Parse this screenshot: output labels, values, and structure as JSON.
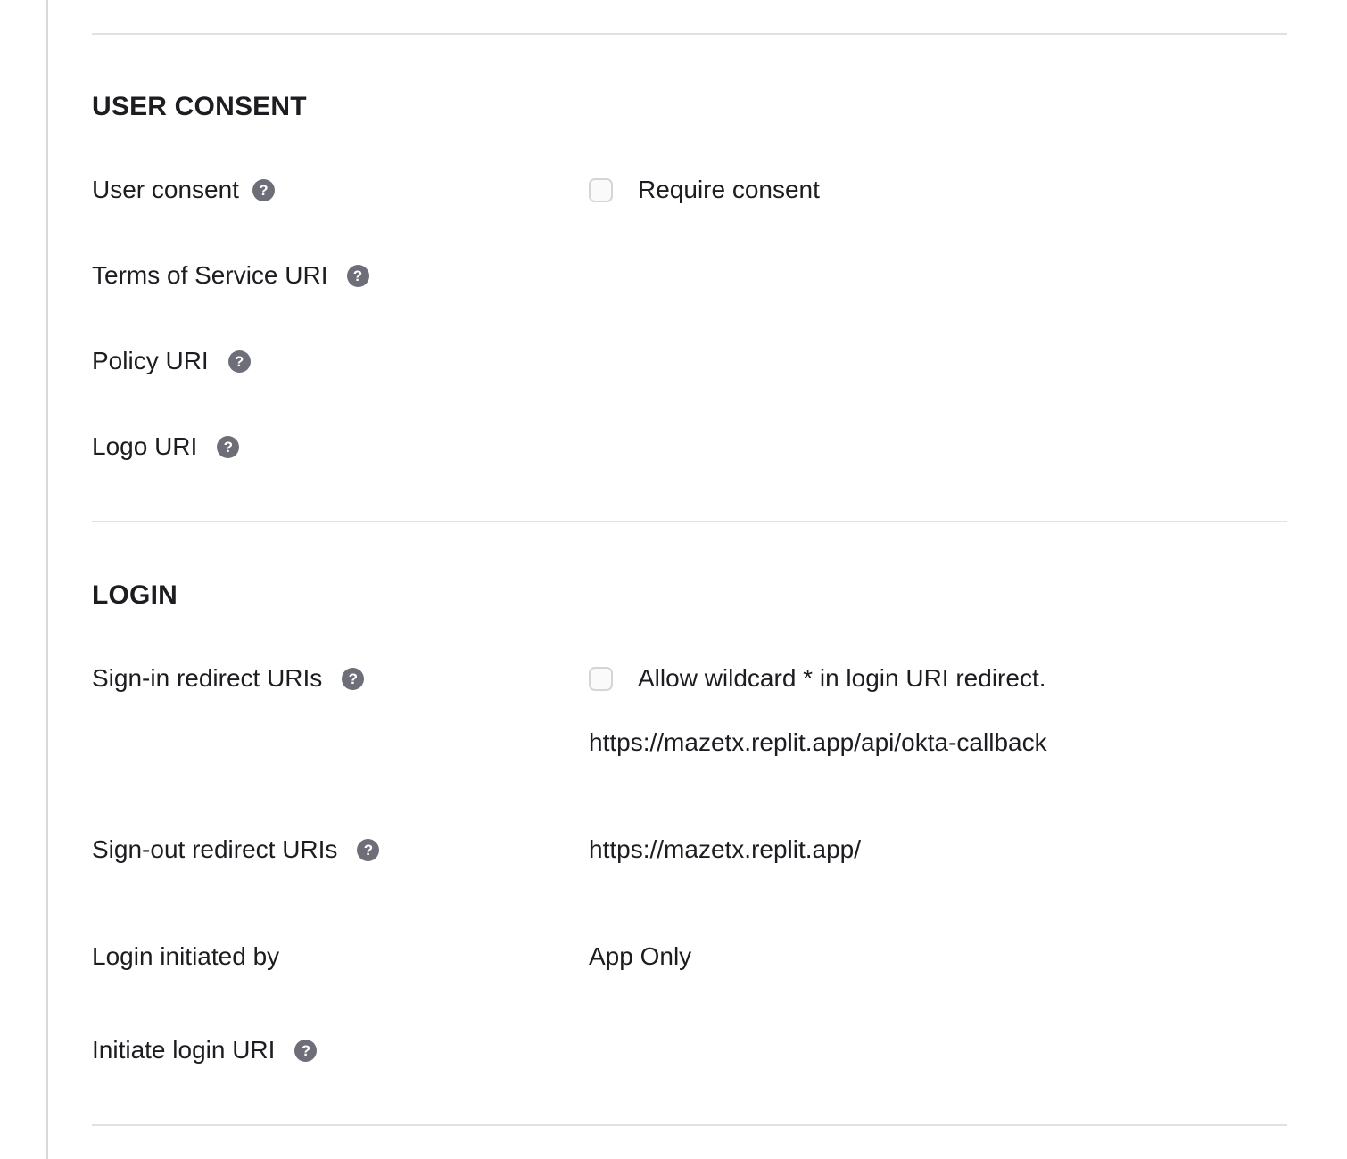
{
  "user_consent_section": {
    "title": "USER CONSENT",
    "user_consent_label": "User consent",
    "require_consent_label": "Require consent",
    "require_consent_checked": false,
    "terms_label": "Terms of Service URI",
    "policy_label": "Policy URI",
    "logo_label": "Logo URI"
  },
  "login_section": {
    "title": "LOGIN",
    "signin_label": "Sign-in redirect URIs",
    "wildcard_label": "Allow wildcard * in login URI redirect.",
    "wildcard_checked": false,
    "signin_uri": "https://mazetx.replit.app/api/okta-callback",
    "signout_label": "Sign-out redirect URIs",
    "signout_uri": "https://mazetx.replit.app/",
    "initiated_by_label": "Login initiated by",
    "initiated_by_value": "App Only",
    "initiate_uri_label": "Initiate login URI"
  },
  "icons": {
    "help": "question-circle-icon",
    "help_glyph": "?"
  }
}
